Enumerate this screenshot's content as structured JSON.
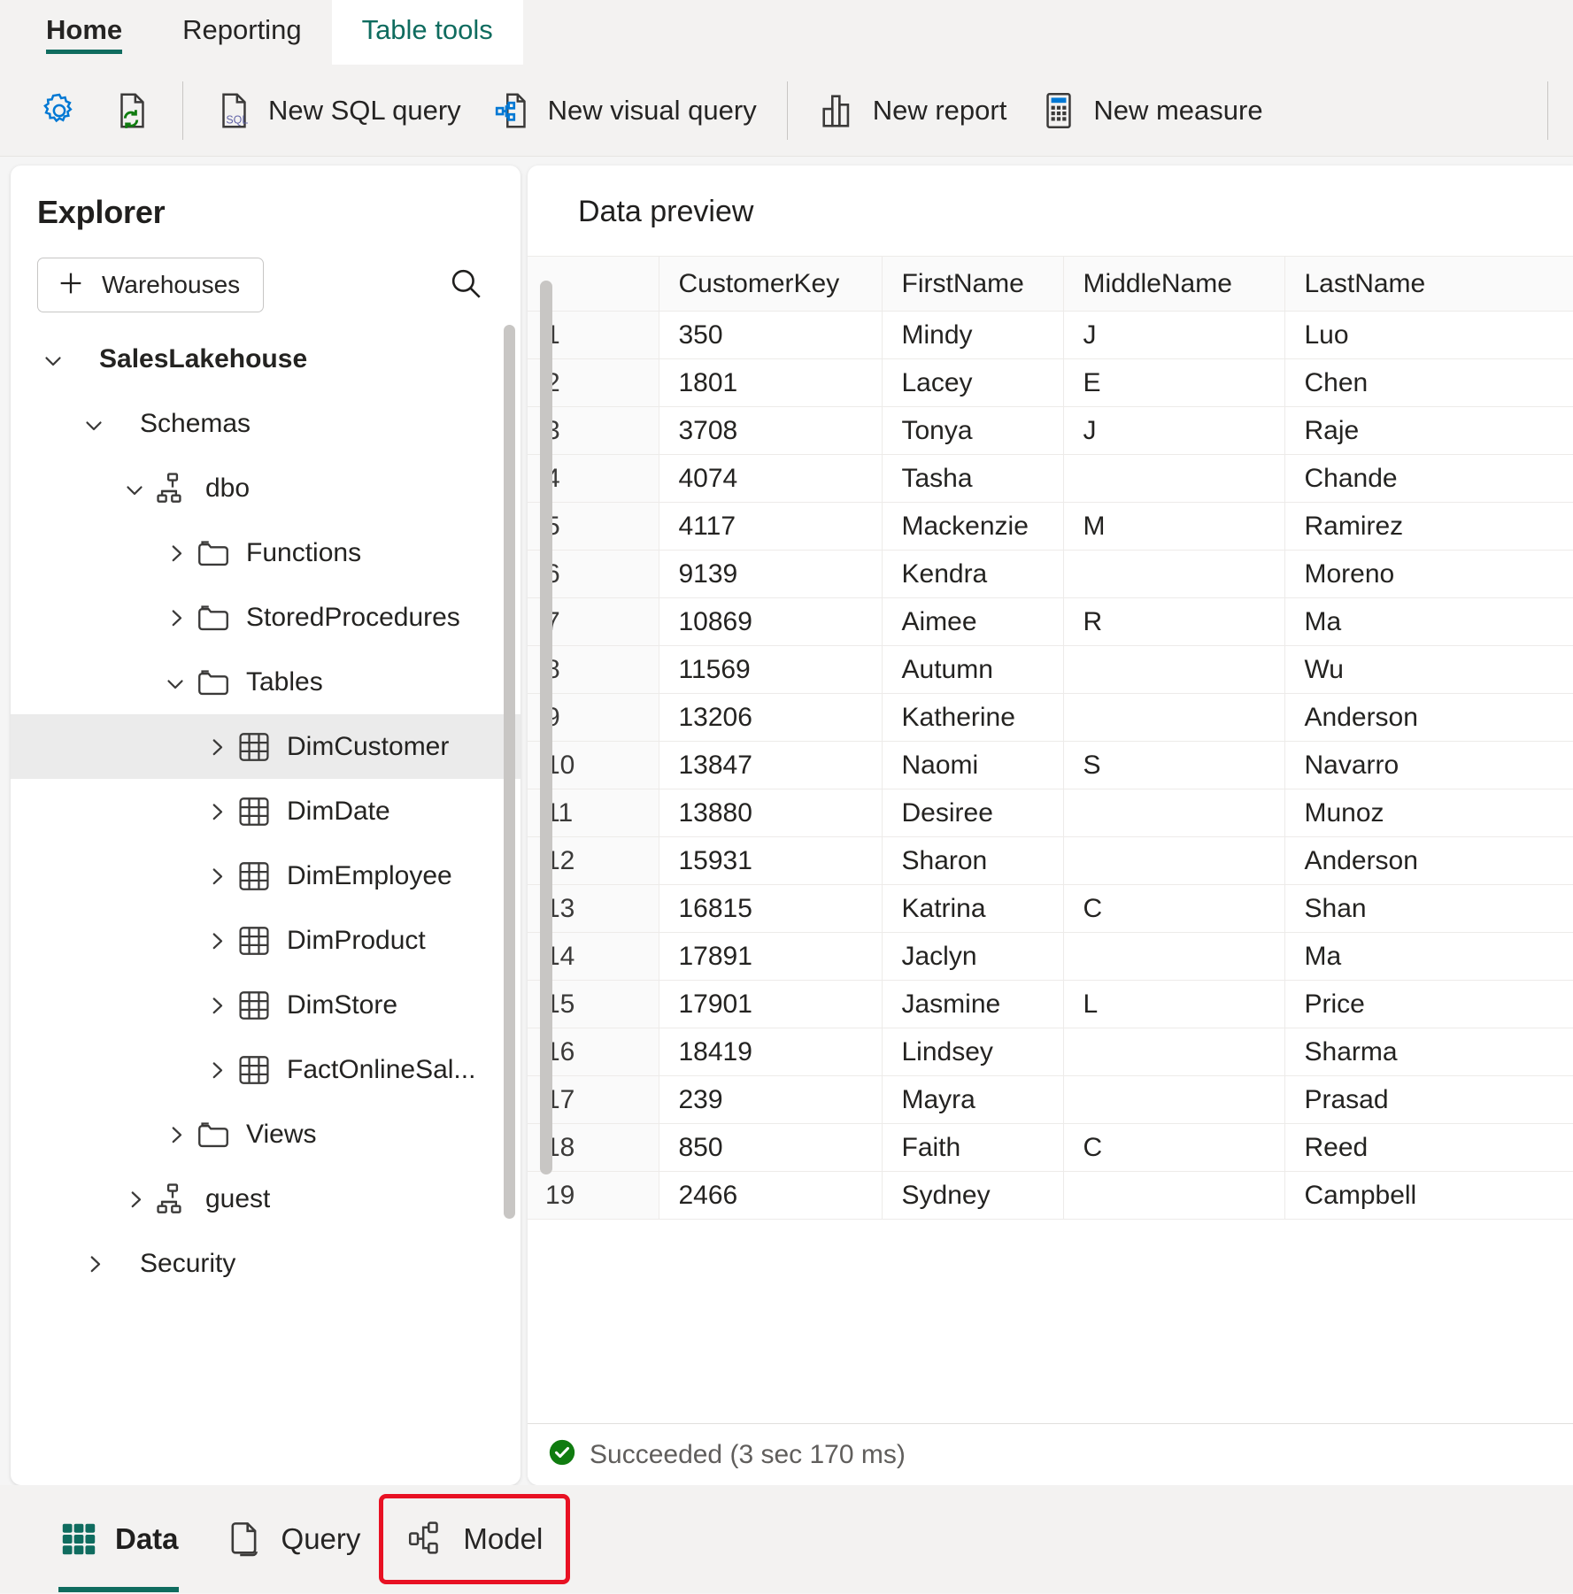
{
  "ribbon": {
    "tabs": [
      {
        "label": "Home",
        "state": "active-underline"
      },
      {
        "label": "Reporting",
        "state": "normal"
      },
      {
        "label": "Table tools",
        "state": "current"
      }
    ]
  },
  "toolbar": {
    "items": [
      {
        "label": "",
        "icon": "settings-gear-icon"
      },
      {
        "label": "",
        "icon": "refresh-file-icon"
      },
      {
        "label": "New SQL query",
        "icon": "sql-file-icon"
      },
      {
        "label": "New visual query",
        "icon": "visual-query-icon"
      },
      {
        "label": "New report",
        "icon": "bar-chart-icon"
      },
      {
        "label": "New measure",
        "icon": "calculator-icon"
      }
    ]
  },
  "explorer": {
    "title": "Explorer",
    "warehouses_button": "Warehouses",
    "search_icon": "search-icon",
    "tree": [
      {
        "label": "SalesLakehouse",
        "indent": 0,
        "chevron": "down",
        "icon": "none",
        "bold": true,
        "selected": false
      },
      {
        "label": "Schemas",
        "indent": 1,
        "chevron": "down",
        "icon": "none",
        "bold": false,
        "selected": false
      },
      {
        "label": "dbo",
        "indent": 2,
        "chevron": "down",
        "icon": "schema-icon",
        "bold": false,
        "selected": false
      },
      {
        "label": "Functions",
        "indent": 3,
        "chevron": "right",
        "icon": "folder-icon",
        "bold": false,
        "selected": false
      },
      {
        "label": "StoredProcedures",
        "indent": 3,
        "chevron": "right",
        "icon": "folder-icon",
        "bold": false,
        "selected": false
      },
      {
        "label": "Tables",
        "indent": 3,
        "chevron": "down",
        "icon": "folder-icon",
        "bold": false,
        "selected": false
      },
      {
        "label": "DimCustomer",
        "indent": 4,
        "chevron": "right",
        "icon": "table-icon",
        "bold": false,
        "selected": true
      },
      {
        "label": "DimDate",
        "indent": 4,
        "chevron": "right",
        "icon": "table-icon",
        "bold": false,
        "selected": false
      },
      {
        "label": "DimEmployee",
        "indent": 4,
        "chevron": "right",
        "icon": "table-icon",
        "bold": false,
        "selected": false
      },
      {
        "label": "DimProduct",
        "indent": 4,
        "chevron": "right",
        "icon": "table-icon",
        "bold": false,
        "selected": false
      },
      {
        "label": "DimStore",
        "indent": 4,
        "chevron": "right",
        "icon": "table-icon",
        "bold": false,
        "selected": false
      },
      {
        "label": "FactOnlineSal...",
        "indent": 4,
        "chevron": "right",
        "icon": "table-icon",
        "bold": false,
        "selected": false
      },
      {
        "label": "Views",
        "indent": 3,
        "chevron": "right",
        "icon": "folder-icon",
        "bold": false,
        "selected": false
      },
      {
        "label": "guest",
        "indent": 2,
        "chevron": "right",
        "icon": "schema-icon",
        "bold": false,
        "selected": false
      },
      {
        "label": "Security",
        "indent": 1,
        "chevron": "right",
        "icon": "none",
        "bold": false,
        "selected": false
      }
    ]
  },
  "preview": {
    "title": "Data preview",
    "columns": [
      "",
      "CustomerKey",
      "FirstName",
      "MiddleName",
      "LastName"
    ],
    "rows": [
      [
        "1",
        "350",
        "Mindy",
        "J",
        "Luo"
      ],
      [
        "2",
        "1801",
        "Lacey",
        "E",
        "Chen"
      ],
      [
        "3",
        "3708",
        "Tonya",
        "J",
        "Raje"
      ],
      [
        "4",
        "4074",
        "Tasha",
        "",
        "Chande"
      ],
      [
        "5",
        "4117",
        "Mackenzie",
        "M",
        "Ramirez"
      ],
      [
        "6",
        "9139",
        "Kendra",
        "",
        "Moreno"
      ],
      [
        "7",
        "10869",
        "Aimee",
        "R",
        "Ma"
      ],
      [
        "8",
        "11569",
        "Autumn",
        "",
        "Wu"
      ],
      [
        "9",
        "13206",
        "Katherine",
        "",
        "Anderson"
      ],
      [
        "10",
        "13847",
        "Naomi",
        "S",
        "Navarro"
      ],
      [
        "11",
        "13880",
        "Desiree",
        "",
        "Munoz"
      ],
      [
        "12",
        "15931",
        "Sharon",
        "",
        "Anderson"
      ],
      [
        "13",
        "16815",
        "Katrina",
        "C",
        "Shan"
      ],
      [
        "14",
        "17891",
        "Jaclyn",
        "",
        "Ma"
      ],
      [
        "15",
        "17901",
        "Jasmine",
        "L",
        "Price"
      ],
      [
        "16",
        "18419",
        "Lindsey",
        "",
        "Sharma"
      ],
      [
        "17",
        "239",
        "Mayra",
        "",
        "Prasad"
      ],
      [
        "18",
        "850",
        "Faith",
        "C",
        "Reed"
      ],
      [
        "19",
        "2466",
        "Sydney",
        "",
        "Campbell"
      ]
    ],
    "status": {
      "text": "Succeeded (3 sec 170 ms)",
      "icon": "success-check-icon",
      "color": "#107c10"
    }
  },
  "bottom_nav": {
    "items": [
      {
        "label": "Data",
        "icon": "data-grid-icon",
        "active": true,
        "highlighted": false
      },
      {
        "label": "Query",
        "icon": "query-page-icon",
        "active": false,
        "highlighted": false
      },
      {
        "label": "Model",
        "icon": "model-diagram-icon",
        "active": false,
        "highlighted": true
      }
    ]
  },
  "colors": {
    "accent_green": "#0f6c5f",
    "highlight_red": "#e81123",
    "success_green": "#107c10",
    "icon_blue": "#0078d4"
  }
}
